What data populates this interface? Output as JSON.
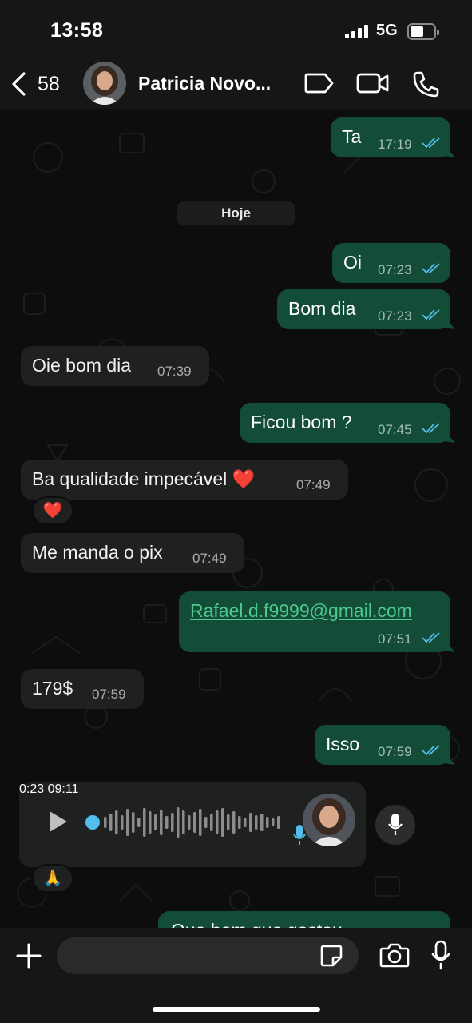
{
  "status_bar": {
    "time": "13:58",
    "network": "5G"
  },
  "header": {
    "back_count": "58",
    "contact_name": "Patricia Novo..."
  },
  "chat": {
    "date_separator": "Hoje",
    "messages": [
      {
        "direction": "out",
        "text": "Ta",
        "time": "17:19",
        "read": true
      },
      {
        "direction": "out",
        "text": "Oi",
        "time": "07:23",
        "read": true
      },
      {
        "direction": "out",
        "text": "Bom dia",
        "time": "07:23",
        "read": true
      },
      {
        "direction": "in",
        "text": "Oie bom dia",
        "time": "07:39"
      },
      {
        "direction": "out",
        "text": "Ficou bom ?",
        "time": "07:45",
        "read": true
      },
      {
        "direction": "in",
        "text": "Ba qualidade impecável ❤️",
        "time": "07:49",
        "reaction": "❤️"
      },
      {
        "direction": "in",
        "text": "Me manda o pix",
        "time": "07:49"
      },
      {
        "direction": "out",
        "text": "Rafael.d.f9999@gmail.com",
        "time": "07:51",
        "read": true
      },
      {
        "direction": "in",
        "text": "179$",
        "time": "07:59"
      },
      {
        "direction": "out",
        "text": "Isso",
        "time": "07:59",
        "read": true
      },
      {
        "direction": "in",
        "type": "voice",
        "elapsed": "0:23",
        "time": "09:11",
        "reaction": "🙏"
      },
      {
        "direction": "out",
        "text": "Que bom que gostou"
      }
    ]
  },
  "composer": {
    "placeholder": ""
  },
  "colors": {
    "outgoing_bubble": "#134d37",
    "incoming_bubble": "#1f2020",
    "read_ticks": "#53bdeb",
    "link": "#4ec98e"
  },
  "icons": [
    "back-chevron-icon",
    "label-tag-icon",
    "video-call-icon",
    "phone-icon",
    "play-icon",
    "mic-icon",
    "plus-icon",
    "sticker-icon",
    "camera-icon"
  ]
}
